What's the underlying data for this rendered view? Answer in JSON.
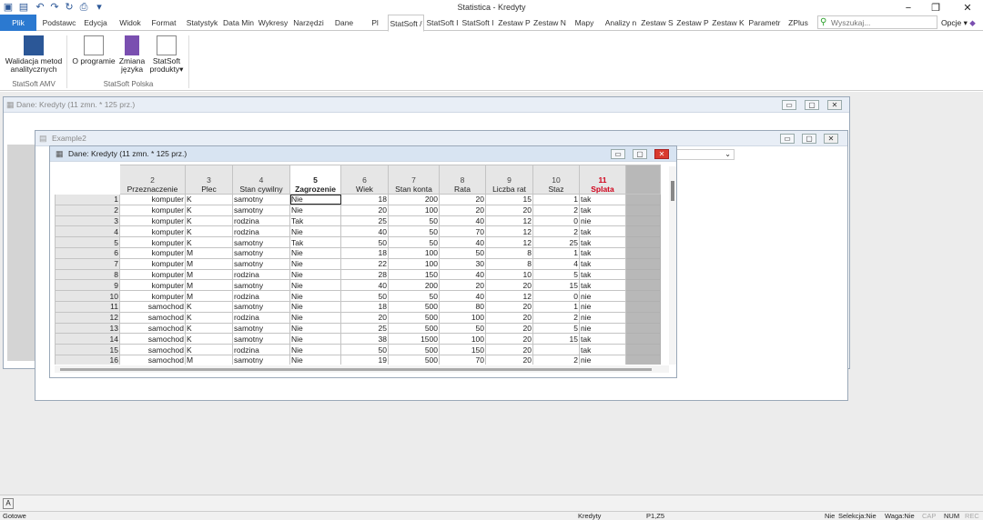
{
  "app": {
    "title": "Statistica - Kredyty"
  },
  "tabs": [
    "Plik",
    "Podstawc",
    "Edycja",
    "Widok",
    "Format",
    "Statystyk",
    "Data Min",
    "Wykresy",
    "Narzędzi",
    "Dane",
    "Pl",
    "StatSoft /",
    "StatSoft I",
    "StatSoft I",
    "Zestaw P",
    "Zestaw N",
    "Mapy",
    "Analizy n",
    "Zestaw S",
    "Zestaw P",
    "Zestaw K",
    "Parametr",
    "ZPlus"
  ],
  "active_tab": "StatSoft /",
  "search": {
    "placeholder": "Wyszukaj..."
  },
  "options_label": "Opcje",
  "ribbon": {
    "buttons": [
      {
        "label1": "Walidacja metod",
        "label2": "analitycznych"
      },
      {
        "label1": "O programie",
        "label2": ""
      },
      {
        "label1": "Zmiana",
        "label2": "języka"
      },
      {
        "label1": "StatSoft",
        "label2": "produkty"
      }
    ],
    "groups": [
      "StatSoft AMV",
      "StatSoft Polska"
    ]
  },
  "windows": {
    "back": "Dane: Kredyty (11 zmn. * 125 prz.)",
    "example": "Example2",
    "front": "Dane: Kredyty (11 zmn. * 125 prz.)"
  },
  "grid": {
    "columns": [
      {
        "num": "2",
        "name": "Przeznaczenie"
      },
      {
        "num": "3",
        "name": "Plec"
      },
      {
        "num": "4",
        "name": "Stan cywilny"
      },
      {
        "num": "5",
        "name": "Zagrozenie"
      },
      {
        "num": "6",
        "name": "Wiek"
      },
      {
        "num": "7",
        "name": "Stan konta"
      },
      {
        "num": "8",
        "name": "Rata"
      },
      {
        "num": "9",
        "name": "Liczba rat"
      },
      {
        "num": "10",
        "name": "Staz"
      },
      {
        "num": "11",
        "name": "Splata"
      }
    ],
    "rows": [
      [
        "1",
        "komputer",
        "K",
        "samotny",
        "Nie",
        "18",
        "200",
        "20",
        "15",
        "1",
        "tak"
      ],
      [
        "2",
        "komputer",
        "K",
        "samotny",
        "Nie",
        "20",
        "100",
        "20",
        "20",
        "2",
        "tak"
      ],
      [
        "3",
        "komputer",
        "K",
        "rodzina",
        "Tak",
        "25",
        "50",
        "40",
        "12",
        "0",
        "nie"
      ],
      [
        "4",
        "komputer",
        "K",
        "rodzina",
        "Nie",
        "40",
        "50",
        "70",
        "12",
        "2",
        "tak"
      ],
      [
        "5",
        "komputer",
        "K",
        "samotny",
        "Tak",
        "50",
        "50",
        "40",
        "12",
        "25",
        "tak"
      ],
      [
        "6",
        "komputer",
        "M",
        "samotny",
        "Nie",
        "18",
        "100",
        "50",
        "8",
        "1",
        "tak"
      ],
      [
        "7",
        "komputer",
        "M",
        "samotny",
        "Nie",
        "22",
        "100",
        "30",
        "8",
        "4",
        "tak"
      ],
      [
        "8",
        "komputer",
        "M",
        "rodzina",
        "Nie",
        "28",
        "150",
        "40",
        "10",
        "5",
        "tak"
      ],
      [
        "9",
        "komputer",
        "M",
        "samotny",
        "Nie",
        "40",
        "200",
        "20",
        "20",
        "15",
        "tak"
      ],
      [
        "10",
        "komputer",
        "M",
        "rodzina",
        "Nie",
        "50",
        "50",
        "40",
        "12",
        "0",
        "nie"
      ],
      [
        "11",
        "samochod",
        "K",
        "samotny",
        "Nie",
        "18",
        "500",
        "80",
        "20",
        "1",
        "nie"
      ],
      [
        "12",
        "samochod",
        "K",
        "rodzina",
        "Nie",
        "20",
        "500",
        "100",
        "20",
        "2",
        "nie"
      ],
      [
        "13",
        "samochod",
        "K",
        "samotny",
        "Nie",
        "25",
        "500",
        "50",
        "20",
        "5",
        "nie"
      ],
      [
        "14",
        "samochod",
        "K",
        "samotny",
        "Nie",
        "38",
        "1500",
        "100",
        "20",
        "15",
        "tak"
      ],
      [
        "15",
        "samochod",
        "K",
        "rodzina",
        "Nie",
        "50",
        "500",
        "150",
        "20",
        "",
        "tak"
      ],
      [
        "16",
        "samochod",
        "M",
        "samotny",
        "Nie",
        "19",
        "500",
        "70",
        "20",
        "2",
        "nie"
      ]
    ]
  },
  "status": {
    "left": "Gotowe",
    "file": "Kredyty",
    "cell": "P1,Z5",
    "nie": "Nie",
    "selekcja": "Selekcja:Nie",
    "waga": "Waga:Nie",
    "cap": "CAP",
    "num": "NUM",
    "rec": "REC"
  }
}
